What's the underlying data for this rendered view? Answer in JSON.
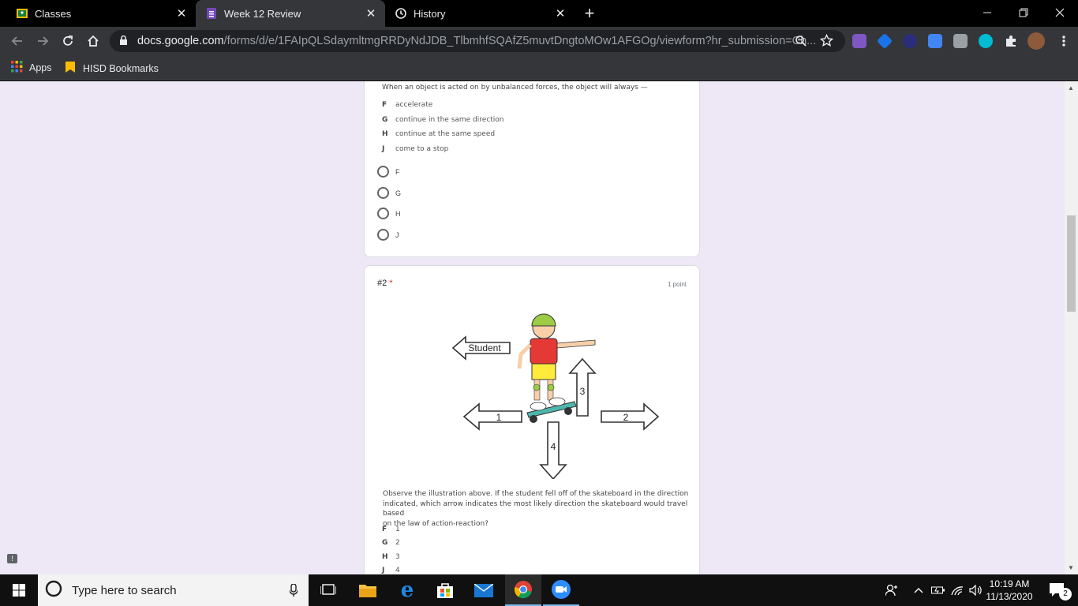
{
  "browser": {
    "tabs": [
      {
        "label": "Classes",
        "active": false
      },
      {
        "label": "Week 12 Review",
        "active": true
      },
      {
        "label": "History",
        "active": false
      }
    ],
    "url_domain": "docs.google.com",
    "url_path": "/forms/d/e/1FAIpQLSdaymltmgRRDyNdJDB_TlbmhfSQAfZ5muvtDngtoMOw1AFGOg/viewform?hr_submission=Ch...",
    "bookmarks": {
      "apps": "Apps",
      "folder": "HISD Bookmarks"
    }
  },
  "form": {
    "q1": {
      "stem": "When an object is acted on by unbalanced forces, the object will always —",
      "choices": [
        {
          "letter": "F",
          "text": "accelerate"
        },
        {
          "letter": "G",
          "text": "continue in the same direction"
        },
        {
          "letter": "H",
          "text": "continue at the same speed"
        },
        {
          "letter": "J",
          "text": "come to a stop"
        }
      ],
      "options": [
        "F",
        "G",
        "H",
        "J"
      ]
    },
    "q2": {
      "title": "#2",
      "required_mark": "*",
      "points": "1 point",
      "figure": {
        "student_label": "Student",
        "arrow1": "1",
        "arrow2": "2",
        "arrow3": "3",
        "arrow4": "4"
      },
      "stem_line1": "Observe the illustration above. If the student fell off of the skateboard in the direction",
      "stem_line2": "indicated, which arrow indicates the most likely direction the skateboard would travel based",
      "stem_line3": "on the law of action-reaction?",
      "choices": [
        {
          "letter": "F",
          "text": "1"
        },
        {
          "letter": "G",
          "text": "2"
        },
        {
          "letter": "H",
          "text": "3"
        },
        {
          "letter": "J",
          "text": "4"
        }
      ]
    }
  },
  "taskbar": {
    "search_placeholder": "Type here to search",
    "time": "10:19 AM",
    "date": "11/13/2020",
    "notification_count": "2"
  }
}
